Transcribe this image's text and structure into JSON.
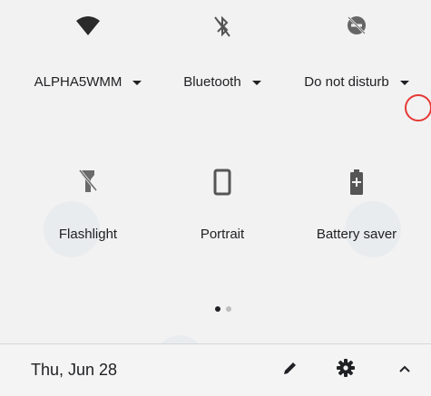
{
  "tiles_row1": [
    {
      "label": "ALPHA5WMM",
      "icon": "wifi-icon",
      "has_dropdown": true
    },
    {
      "label": "Bluetooth",
      "icon": "bluetooth-off-icon",
      "has_dropdown": true
    },
    {
      "label": "Do not disturb",
      "icon": "do-not-disturb-off-icon",
      "has_dropdown": true,
      "highlighted": true
    }
  ],
  "tiles_row2": [
    {
      "label": "Flashlight",
      "icon": "flashlight-off-icon"
    },
    {
      "label": "Portrait",
      "icon": "portrait-icon"
    },
    {
      "label": "Battery saver",
      "icon": "battery-saver-icon"
    }
  ],
  "pager": {
    "pages": 2,
    "current": 1
  },
  "footer": {
    "date": "Thu, Jun 28",
    "edit_icon": "pencil-icon",
    "settings_icon": "gear-icon",
    "collapse_icon": "chevron-up-icon"
  },
  "colors": {
    "background": "#f2f2f2",
    "icon": "#424242",
    "highlight": "#e53935",
    "dot_active": "#202124",
    "dot_inactive": "#bdbdbd"
  }
}
